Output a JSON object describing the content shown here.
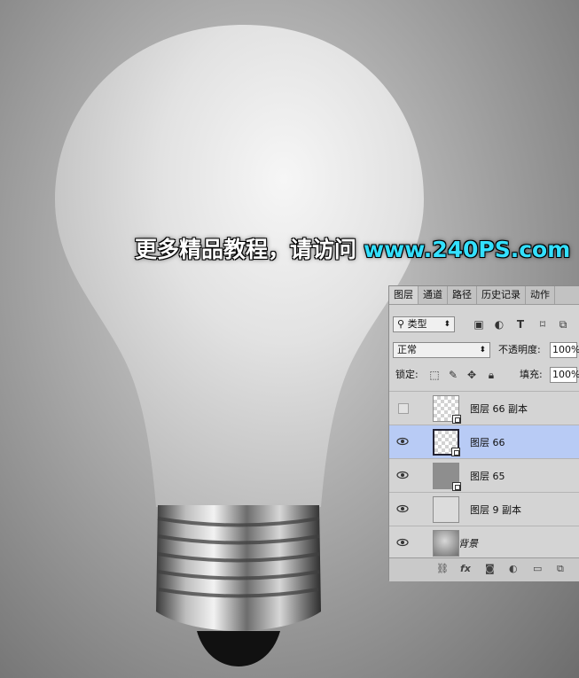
{
  "watermark": {
    "text_cn": "更多精品教程，请访问",
    "text_url": "www.240PS.com"
  },
  "colors": {
    "watermark_url": "#33e0ff",
    "selected_layer": "#b8cbf5",
    "panel_bg": "#d4d4d4"
  },
  "panel": {
    "tabs": [
      "图层",
      "通道",
      "路径",
      "历史记录",
      "动作"
    ],
    "active_tab": "图层",
    "filter": {
      "kind_label": "类型",
      "search_icon": "search-icon",
      "filter_icons": [
        "image-filter-icon",
        "adjustment-filter-icon",
        "text-filter-icon",
        "shape-filter-icon",
        "smart-object-filter-icon"
      ]
    },
    "blend_mode": "正常",
    "opacity_label": "不透明度:",
    "opacity_value": "100%",
    "lock_label": "锁定:",
    "fill_label": "填充:",
    "fill_value": "100%",
    "layers": [
      {
        "name": "图层 66 副本",
        "visible": false,
        "selected": false,
        "thumb": "transparent-smart"
      },
      {
        "name": "图层 66",
        "visible": true,
        "selected": true,
        "thumb": "transparent-smart"
      },
      {
        "name": "图层 65",
        "visible": true,
        "selected": false,
        "thumb": "gray-smart"
      },
      {
        "name": "图层 9 副本",
        "visible": true,
        "selected": false,
        "thumb": "plain"
      },
      {
        "name": "背景",
        "visible": true,
        "selected": false,
        "thumb": "gradient"
      }
    ],
    "bottom_icons": [
      "link-icon",
      "fx-icon",
      "mask-icon",
      "adjustment-icon",
      "folder-icon",
      "new-layer-icon"
    ],
    "fx_label": "fx"
  }
}
